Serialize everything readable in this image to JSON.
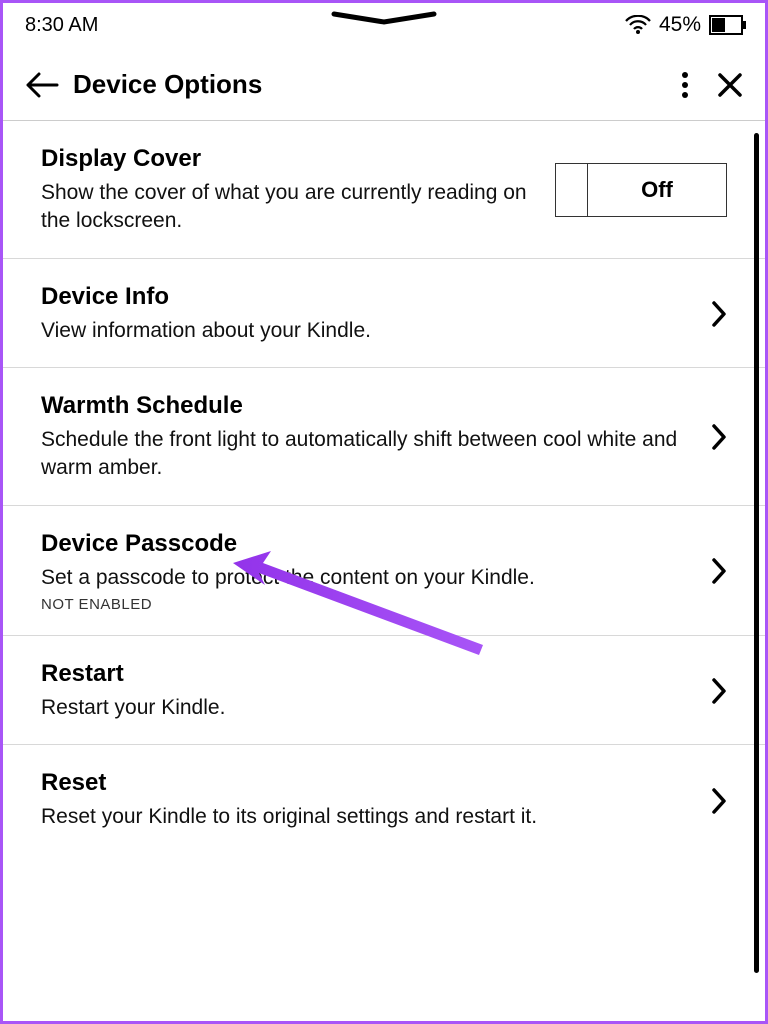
{
  "statusbar": {
    "time": "8:30 AM",
    "battery_pct": "45%"
  },
  "header": {
    "title": "Device Options"
  },
  "rows": {
    "display_cover": {
      "title": "Display Cover",
      "desc": "Show the cover of what you are currently reading on the lockscreen.",
      "toggle_state": "Off"
    },
    "device_info": {
      "title": "Device Info",
      "desc": "View information about your Kindle."
    },
    "warmth": {
      "title": "Warmth Schedule",
      "desc": "Schedule the front light to automatically shift between cool white and warm amber."
    },
    "passcode": {
      "title": "Device Passcode",
      "desc": "Set a passcode to protect the content on your Kindle.",
      "status": "NOT ENABLED"
    },
    "restart": {
      "title": "Restart",
      "desc": "Restart your Kindle."
    },
    "reset": {
      "title": "Reset",
      "desc": "Reset your Kindle to its original settings and restart it."
    }
  }
}
